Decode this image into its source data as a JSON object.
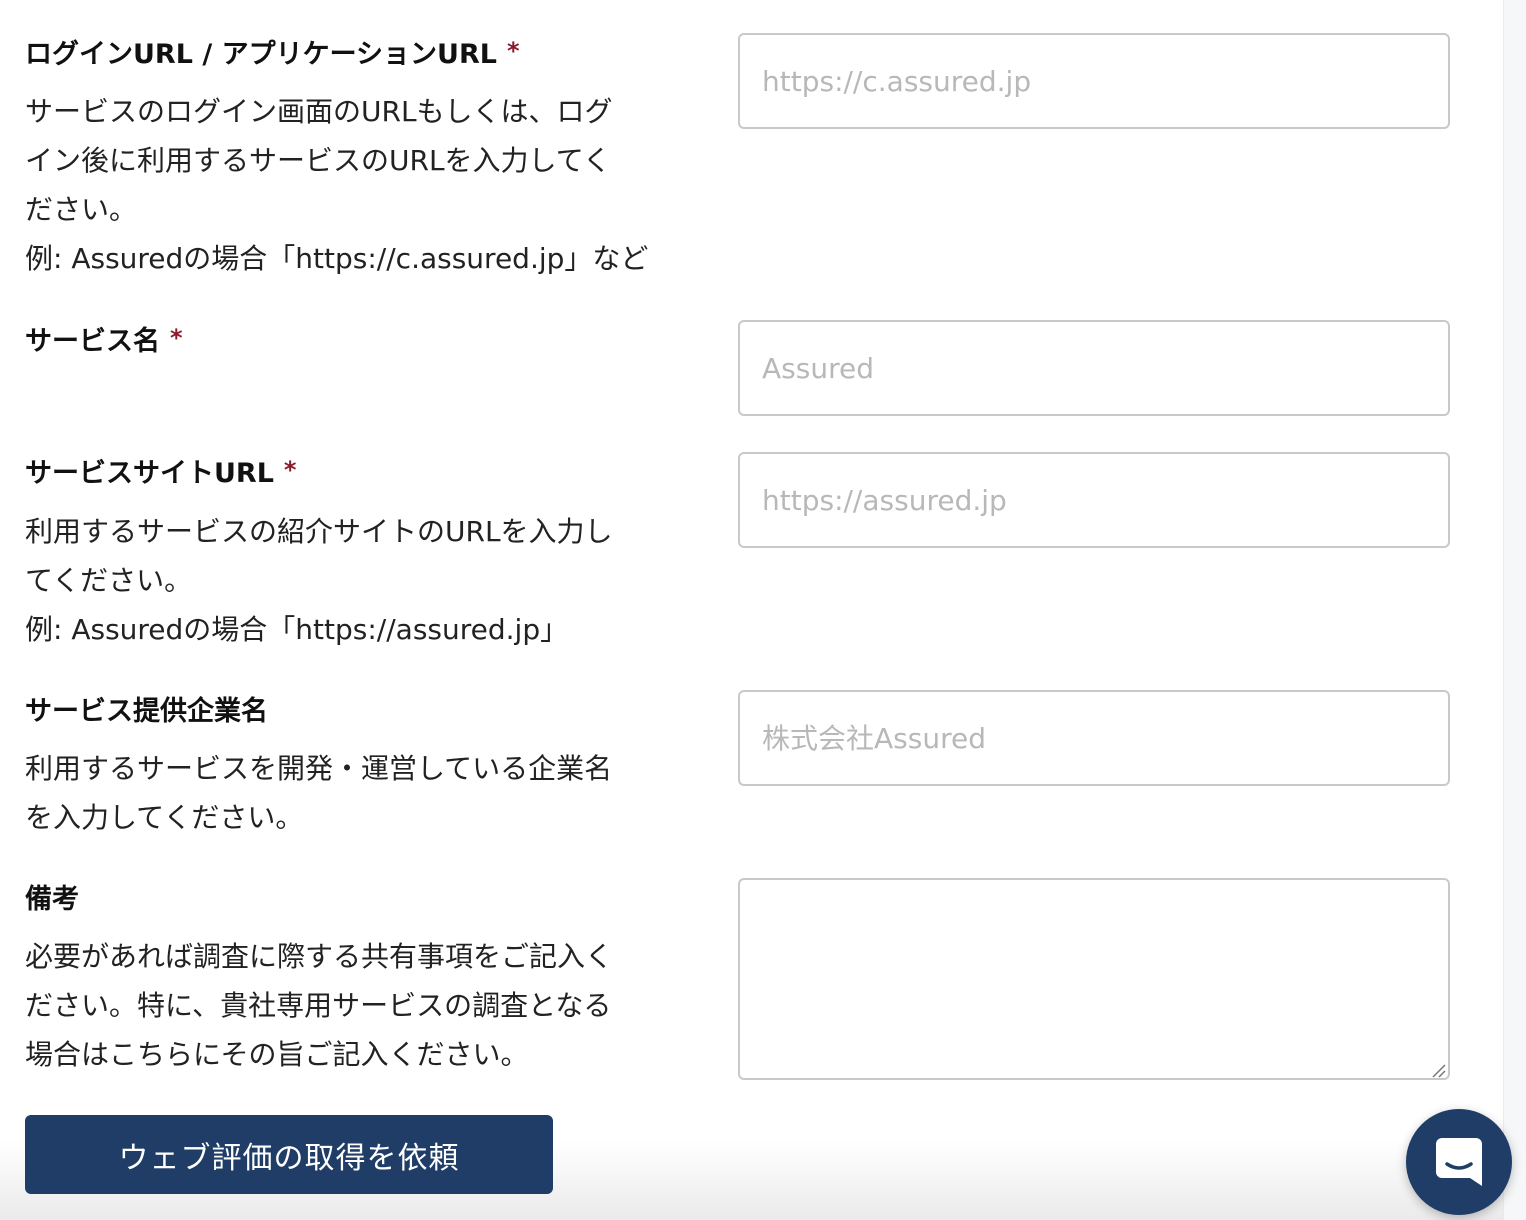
{
  "fields": [
    {
      "label": "ログインURL / アプリケーションURL",
      "required_mark": "*",
      "help": [
        "サービスのログイン画面のURLもしくは、ログ",
        "イン後に利用するサービスのURLを入力してく",
        "ださい。",
        "例: Assuredの場合「https://c.assured.jp」など"
      ],
      "value": "",
      "placeholder": "https://c.assured.jp"
    },
    {
      "label": "サービス名",
      "required_mark": "*",
      "help": [],
      "value": "",
      "placeholder": "Assured"
    },
    {
      "label": "サービスサイトURL",
      "required_mark": "*",
      "help": [
        "利用するサービスの紹介サイトのURLを入力し",
        "てください。",
        "例: Assuredの場合「https://assured.jp」"
      ],
      "value": "",
      "placeholder": "https://assured.jp"
    },
    {
      "label": "サービス提供企業名",
      "required_mark": "",
      "help": [
        "利用するサービスを開発・運営している企業名",
        "を入力してください。"
      ],
      "value": "",
      "placeholder": "株式会社Assured"
    },
    {
      "label": "備考",
      "required_mark": "",
      "help": [
        "必要があれば調査に際する共有事項をご記入く",
        "ださい。特に、貴社専用サービスの調査となる",
        "場合はこちらにその旨ご記入ください。"
      ],
      "value": "",
      "placeholder": ""
    }
  ],
  "submit": {
    "label": "ウェブ評価の取得を依頼"
  },
  "chat": {
    "icon": "chat-bubble-icon"
  },
  "colors": {
    "accent": "#1f3d66",
    "required": "#8b1a2b",
    "input_border": "#c9c9c9",
    "placeholder": "#b8b8b8"
  }
}
